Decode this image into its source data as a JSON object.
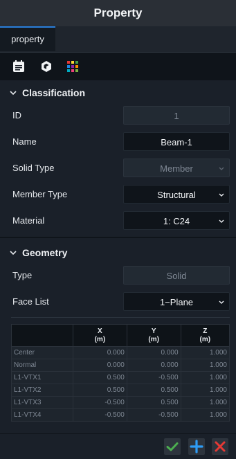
{
  "window": {
    "title": "Property"
  },
  "tabs": [
    {
      "label": "property"
    }
  ],
  "toolbar": {
    "icons": [
      "document-list-icon",
      "cube-icon",
      "color-palette-icon"
    ]
  },
  "classification": {
    "title": "Classification",
    "id_label": "ID",
    "id_value": "1",
    "name_label": "Name",
    "name_value": "Beam-1",
    "solid_type_label": "Solid Type",
    "solid_type_value": "Member",
    "member_type_label": "Member Type",
    "member_type_value": "Structural",
    "material_label": "Material",
    "material_value": "1: C24"
  },
  "geometry": {
    "title": "Geometry",
    "type_label": "Type",
    "type_value": "Solid",
    "face_list_label": "Face List",
    "face_list_value": "1−Plane"
  },
  "table": {
    "headers": [
      {
        "axis": "X",
        "unit": "(m)"
      },
      {
        "axis": "Y",
        "unit": "(m)"
      },
      {
        "axis": "Z",
        "unit": "(m)"
      }
    ],
    "rows": [
      {
        "label": "Center",
        "x": "0.000",
        "y": "0.000",
        "z": "1.000"
      },
      {
        "label": "Normal",
        "x": "0.000",
        "y": "0.000",
        "z": "1.000"
      },
      {
        "label": "L1-VTX1",
        "x": "0.500",
        "y": "-0.500",
        "z": "1.000"
      },
      {
        "label": "L1-VTX2",
        "x": "0.500",
        "y": "0.500",
        "z": "1.000"
      },
      {
        "label": "L1-VTX3",
        "x": "-0.500",
        "y": "0.500",
        "z": "1.000"
      },
      {
        "label": "L1-VTX4",
        "x": "-0.500",
        "y": "-0.500",
        "z": "1.000"
      }
    ]
  },
  "colors": {
    "accent": "#2a7fdc",
    "ok": "#4caf50",
    "add": "#2e9cf5",
    "cancel": "#e53935"
  }
}
